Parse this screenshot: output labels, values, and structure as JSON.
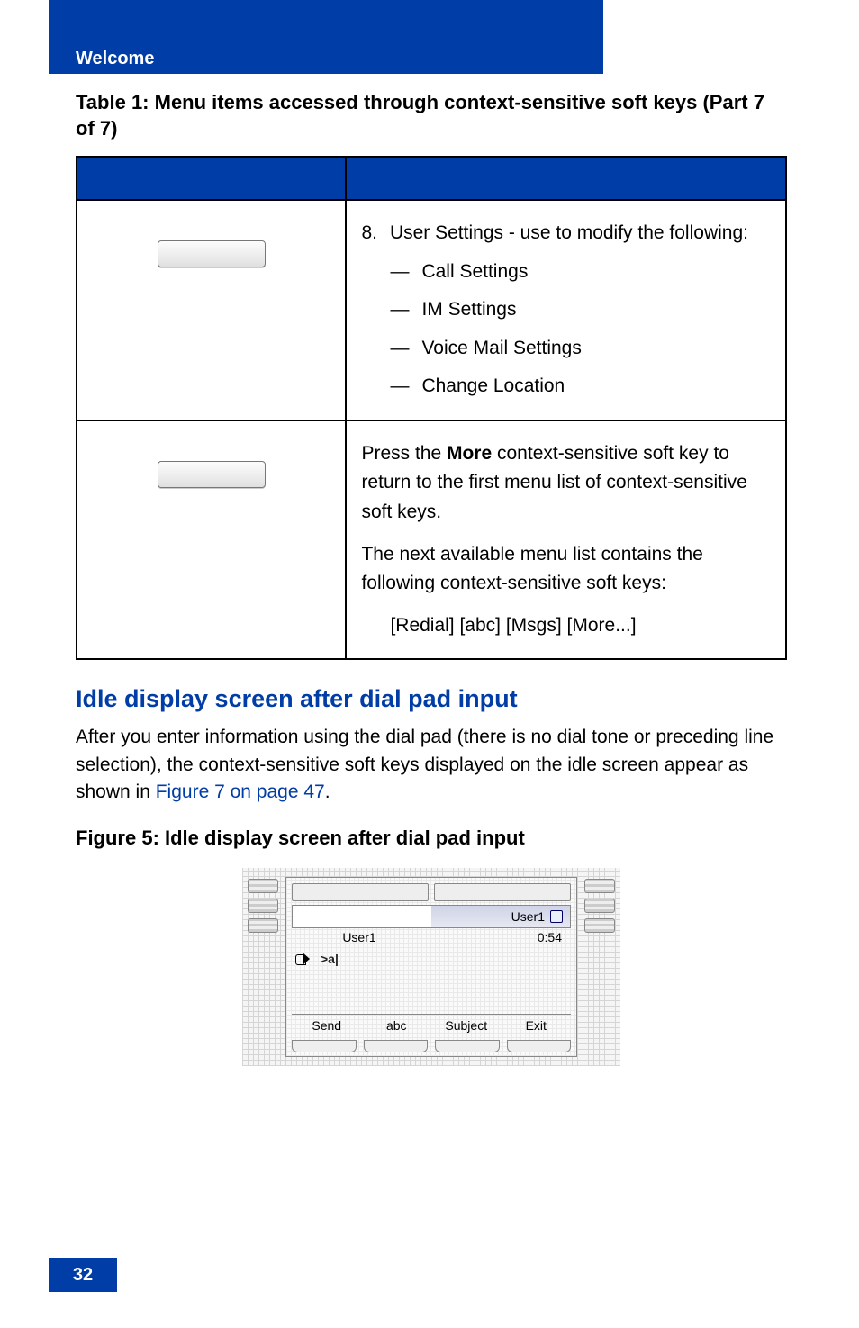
{
  "header": {
    "section": "Welcome"
  },
  "table": {
    "caption": "Table 1: Menu items accessed through context-sensitive soft keys (Part 7 of 7)",
    "rows": [
      {
        "num": "8.",
        "lead": "User Settings - use to modify the following:",
        "bullets": [
          "Call Settings",
          "IM Settings",
          "Voice Mail Settings",
          "Change Location"
        ]
      },
      {
        "para1_a": "Press the ",
        "softkey": "More",
        "para1_b": " context-sensitive soft key to return to the first menu list of context-sensitive soft keys.",
        "para2": "The next available menu list contains the following context-sensitive soft keys:",
        "keys_line": "[Redial] [abc] [Msgs] [More...]"
      }
    ]
  },
  "section": {
    "heading": "Idle display screen after dial pad input",
    "body_a": "After you enter information using the dial pad (there is no dial tone or preceding line selection), the context-sensitive soft keys displayed on the idle screen appear as shown in ",
    "link": "Figure 7 on page 47",
    "body_b": "."
  },
  "figure": {
    "caption": "Figure 5: Idle display screen after dial pad input",
    "lcd": {
      "status_right": "User1",
      "user_left": "User1",
      "user_right": "0:54",
      "input_text": ">a|",
      "softkeys": [
        "Send",
        "abc",
        "Subject",
        "Exit"
      ]
    }
  },
  "page_number": "32"
}
